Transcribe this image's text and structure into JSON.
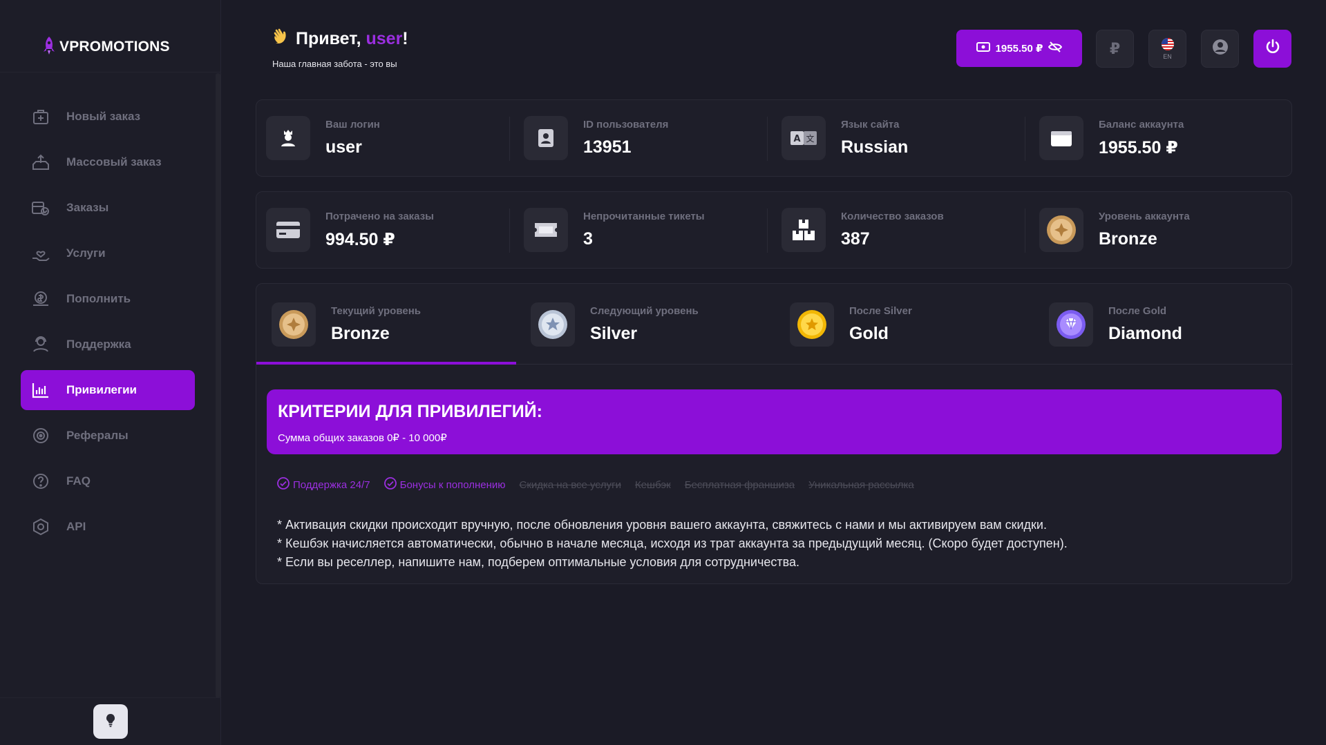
{
  "brand": {
    "name": "VPROMOTIONS",
    "accent": "#8c0fd8"
  },
  "sidebar": {
    "items": [
      {
        "label": "Новый заказ",
        "icon": "new-order-icon"
      },
      {
        "label": "Массовый заказ",
        "icon": "upload-icon"
      },
      {
        "label": "Заказы",
        "icon": "orders-icon"
      },
      {
        "label": "Услуги",
        "icon": "services-icon"
      },
      {
        "label": "Пополнить",
        "icon": "wallet-icon"
      },
      {
        "label": "Поддержка",
        "icon": "support-icon"
      },
      {
        "label": "Привилегии",
        "icon": "chart-icon",
        "active": true
      },
      {
        "label": "Рефералы",
        "icon": "target-icon"
      },
      {
        "label": "FAQ",
        "icon": "question-icon"
      },
      {
        "label": "API",
        "icon": "api-icon"
      }
    ]
  },
  "header": {
    "greeting_prefix": "Привет, ",
    "greeting_user": "user",
    "greeting_suffix": "!",
    "subtitle": "Наша главная забота - это вы",
    "balance_label": "1955.50 ₽",
    "currency_symbol": "₽",
    "lang_code": "EN"
  },
  "stats_row1": [
    {
      "label": "Ваш логин",
      "value": "user"
    },
    {
      "label": "ID пользователя",
      "value": "13951"
    },
    {
      "label": "Язык сайта",
      "value": "Russian"
    },
    {
      "label": "Баланс аккаунта",
      "value": "1955.50 ₽"
    }
  ],
  "stats_row2": [
    {
      "label": "Потрачено на заказы",
      "value": "994.50 ₽"
    },
    {
      "label": "Непрочитанные тикеты",
      "value": "3"
    },
    {
      "label": "Количество заказов",
      "value": "387"
    },
    {
      "label": "Уровень аккаунта",
      "value": "Bronze"
    }
  ],
  "levels": [
    {
      "label": "Текущий уровень",
      "value": "Bronze",
      "active": true
    },
    {
      "label": "Следующий уровень",
      "value": "Silver"
    },
    {
      "label": "После Silver",
      "value": "Gold"
    },
    {
      "label": "После Gold",
      "value": "Diamond"
    }
  ],
  "criteria": {
    "title": "КРИТЕРИИ ДЛЯ ПРИВИЛЕГИЙ:",
    "subtitle": "Сумма общих заказов 0₽ - 10 000₽"
  },
  "perks": [
    {
      "label": "Поддержка 24/7",
      "enabled": true
    },
    {
      "label": "Бонусы к пополнению",
      "enabled": true
    },
    {
      "label": "Скидка на все услуги",
      "enabled": false
    },
    {
      "label": "Кешбэк",
      "enabled": false
    },
    {
      "label": "Бесплатная франшиза",
      "enabled": false
    },
    {
      "label": "Уникальная рассылка",
      "enabled": false
    }
  ],
  "notes": [
    "* Активация скидки происходит вручную, после обновления уровня вашего аккаунта, свяжитесь с нами и мы активируем вам скидки.",
    "* Кешбэк начисляется автоматически, обычно в начале месяца, исходя из трат аккаунта за предыдущий месяц. (Скоро будет доступен).",
    "* Если вы реселлер, напишите нам, подберем оптимальные условия для сотрудничества."
  ]
}
